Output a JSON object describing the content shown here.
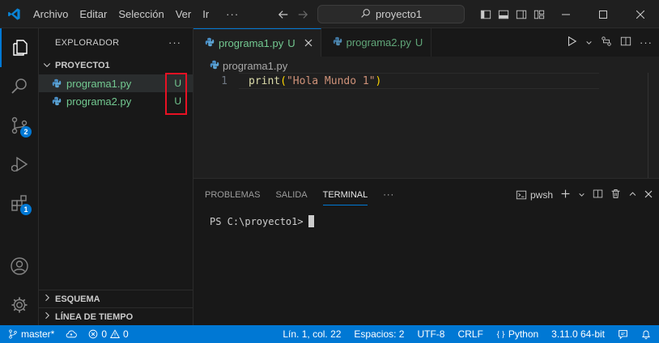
{
  "titlebar": {
    "menu": [
      "Archivo",
      "Editar",
      "Selección",
      "Ver",
      "Ir"
    ],
    "more": "···",
    "search_text": "proyecto1"
  },
  "activity": {
    "scm_badge": "2",
    "extensions_badge": "1"
  },
  "sidebar": {
    "title": "EXPLORADOR",
    "more": "···",
    "folder": "PROYECTO1",
    "files": [
      {
        "name": "programa1.py",
        "status": "U"
      },
      {
        "name": "programa2.py",
        "status": "U"
      }
    ],
    "outline": "ESQUEMA",
    "timeline": "LÍNEA DE TIEMPO"
  },
  "editor": {
    "tabs": [
      {
        "name": "programa1.py",
        "status": "U"
      },
      {
        "name": "programa2.py",
        "status": "U"
      }
    ],
    "breadcrumb": "programa1.py",
    "line_number": "1",
    "code_fn": "print",
    "code_str": "\"Hola Mundo 1\""
  },
  "panel": {
    "tabs": [
      "PROBLEMAS",
      "SALIDA",
      "TERMINAL"
    ],
    "more": "···",
    "profile": "pwsh",
    "prompt": "PS C:\\proyecto1>"
  },
  "statusbar": {
    "branch": "master*",
    "errors": "0",
    "warnings": "0",
    "position": "Lín. 1, col. 22",
    "spaces": "Espacios: 2",
    "encoding": "UTF-8",
    "eol": "CRLF",
    "language": "Python",
    "interpreter": "3.11.0 64-bit"
  },
  "colors": {
    "accent": "#0078d4",
    "untracked": "#73c991",
    "highlight_box": "#e81123"
  }
}
